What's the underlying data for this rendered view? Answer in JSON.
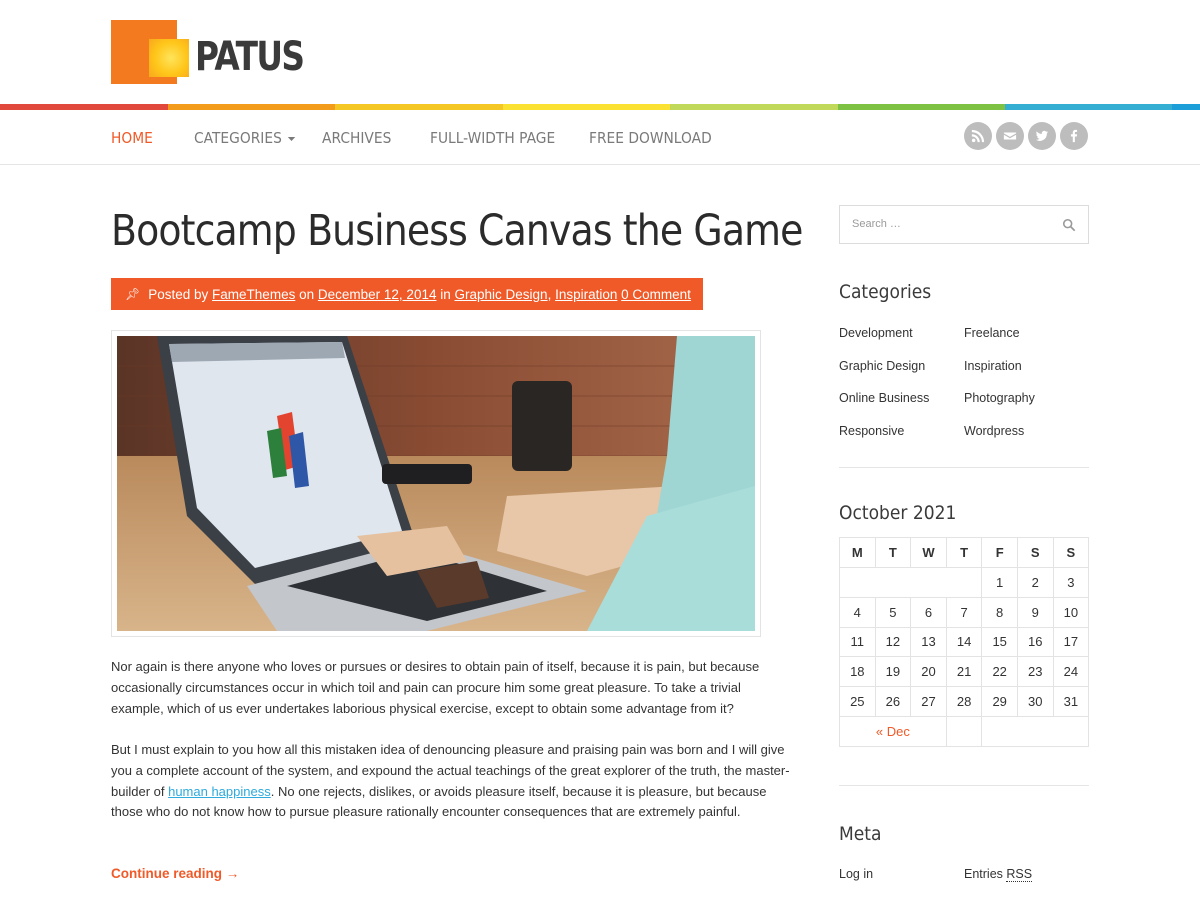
{
  "site": {
    "name": "PATUS"
  },
  "colors": {
    "accent": "#f05a28",
    "rainbow": [
      "#e0493b",
      "#f39c1b",
      "#f5c724",
      "#fbe131",
      "#c0d95a",
      "#7dc242",
      "#34afd3",
      "#1c9fd9"
    ]
  },
  "nav": {
    "items": [
      {
        "label": "HOME",
        "active": true
      },
      {
        "label": "CATEGORIES",
        "has_dropdown": true
      },
      {
        "label": "ARCHIVES"
      },
      {
        "label": "FULL-WIDTH PAGE"
      },
      {
        "label": "FREE DOWNLOAD"
      }
    ],
    "social_icons": [
      "rss-icon",
      "email-icon",
      "twitter-icon",
      "facebook-icon"
    ]
  },
  "post": {
    "title": "Bootcamp Business Canvas the Game",
    "meta": {
      "posted_by": "Posted by",
      "author": "FameThemes",
      "on": "on",
      "date": "December 12, 2014",
      "in": "in",
      "cat1": "Graphic Design",
      "sep": ",",
      "cat2": "Inspiration",
      "comments": "0 Comment"
    },
    "para1": "Nor again is there anyone who loves or pursues or desires to obtain pain of itself, because it is pain, but because occasionally circumstances occur in which toil and pain can procure him some great pleasure. To take a trivial example, which of us ever undertakes laborious physical exercise, except to obtain some advantage from it?",
    "para2_before": "But I must explain to you how all this mistaken idea of denouncing pleasure and praising pain was born and I will give you a complete account of the system, and expound the actual teachings of the great explorer of the truth, the master-builder of ",
    "para2_link": "human happiness",
    "para2_after": ". No one rejects, dislikes, or avoids pleasure itself, because it is pleasure, but because those who do not know how to pursue pleasure rationally encounter consequences that are extremely painful.",
    "continue": "Continue reading →"
  },
  "sidebar": {
    "search_placeholder": "Search …",
    "categories_title": "Categories",
    "categories": [
      "Development",
      "Freelance",
      "Graphic Design",
      "Inspiration",
      "Online Business",
      "Photography",
      "Responsive",
      "Wordpress"
    ],
    "calendar": {
      "title": "October 2021",
      "days": [
        "M",
        "T",
        "W",
        "T",
        "F",
        "S",
        "S"
      ],
      "weeks": [
        [
          "",
          "",
          "",
          "",
          "1",
          "2",
          "3"
        ],
        [
          "4",
          "5",
          "6",
          "7",
          "8",
          "9",
          "10"
        ],
        [
          "11",
          "12",
          "13",
          "14",
          "15",
          "16",
          "17"
        ],
        [
          "18",
          "19",
          "20",
          "21",
          "22",
          "23",
          "24"
        ],
        [
          "25",
          "26",
          "27",
          "28",
          "29",
          "30",
          "31"
        ]
      ],
      "prev": "« Dec"
    },
    "meta_title": "Meta",
    "meta_login": "Log in",
    "meta_entries": "Entries",
    "meta_rss": "RSS"
  }
}
